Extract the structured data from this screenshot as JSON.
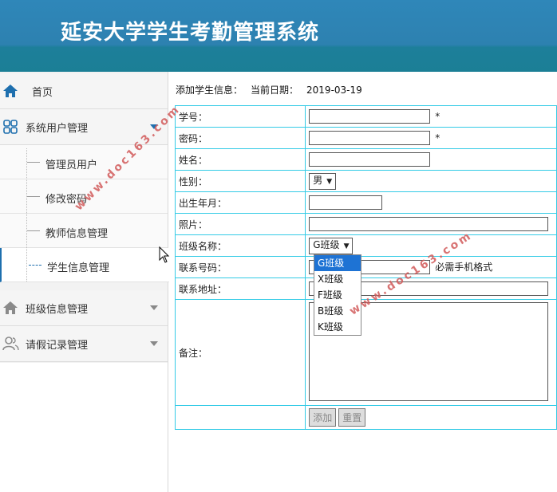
{
  "app": {
    "title": "延安大学学生考勤管理系统"
  },
  "sidebar": {
    "home": "首页",
    "system": "系统用户管理",
    "sub_items": [
      "管理员用户",
      "修改密码",
      "教师信息管理",
      "学生信息管理"
    ],
    "class": "班级信息管理",
    "leave": "请假记录管理"
  },
  "breadcrumb": {
    "action": "添加学生信息：",
    "date_label": "当前日期：",
    "date": "2019-03-19"
  },
  "form": {
    "student_id": "学号：",
    "password": "密码：",
    "name": "姓名：",
    "gender": "性别：",
    "gender_value": "男",
    "birth": "出生年月：",
    "photo": "照片：",
    "class_name": "班级名称：",
    "class_value": "G班级",
    "phone": "联系号码：",
    "phone_hint": "必需手机格式",
    "address": "联系地址：",
    "remark": "备注：",
    "required_mark": "*"
  },
  "class_options": [
    "G班级",
    "X班级",
    "F班级",
    "B班级",
    "K班级"
  ],
  "buttons": {
    "add": "添加",
    "reset": "重置"
  },
  "watermark": "www.doc163.com",
  "colors": {
    "header": "#2d81b0",
    "table_border": "#33cbe6",
    "highlight": "#1e73d4",
    "watermark": "#d25b5b"
  }
}
